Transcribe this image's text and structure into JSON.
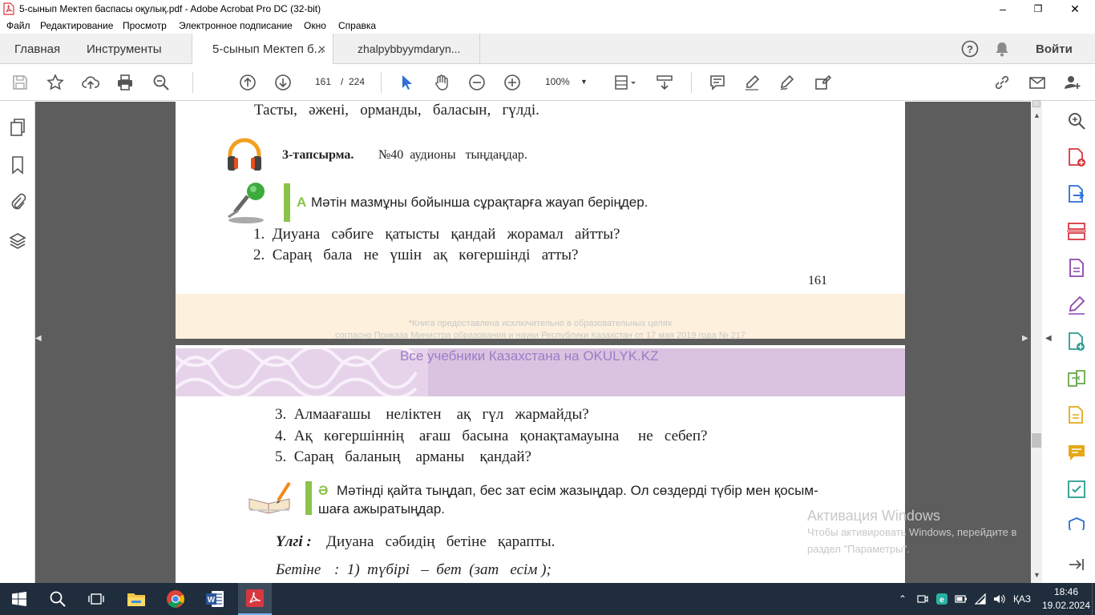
{
  "window": {
    "title": "5-сынып Мектеп баспасы оқулық.pdf - Adobe Acrobat Pro DC (32-bit)",
    "minimize": "–",
    "maximize": "❐",
    "close": "✕"
  },
  "menu": [
    "Файл",
    "Редактирование",
    "Просмотр",
    "Электронное подписание",
    "Окно",
    "Справка"
  ],
  "tabs": {
    "home": "Главная",
    "tools": "Инструменты",
    "doc1": "5-сынып Мектеп б...",
    "doc2": "zhalpybbyymdaryn...",
    "close": "✕",
    "signin": "Войти"
  },
  "toolbar": {
    "current_page": "161",
    "page_sep": "/",
    "total_pages": "224",
    "zoom": "100%"
  },
  "page_top": {
    "line_prev": "Тасты,   әжені,   орманды,   баласын,   гүлді.",
    "task_label": "3-тапсырма.",
    "task_text": "№40  аудионы   тыңдаңдар.",
    "section_a_letter": "А",
    "section_a_text": "Мәтін мазмұны бойынша сұрақтарға жауап беріңдер.",
    "q1": "1.  Диуана   сәбиге   қатысты   қандай   жорамал   айтты?",
    "q2": "2.  Сараң   бала   не   үшін   ақ   көгершінді   атты?",
    "page_number": "161",
    "footer_note1": "*Книга предоставлена исключительно в образовательных целях",
    "footer_note2": "согласно Приказа Министра образования и науки Республики Казахстан от 17 мая 2019 года № 217"
  },
  "page_bottom": {
    "banner_text": "Все учебники Казахстана на OKULYK.KZ",
    "q3": "3.  Алмаағашы    неліктен    ақ   гүл   жармайды?",
    "q4": "4.  Ақ   көгершіннің    ағаш   басына   қонақтамауына     не   себеп?",
    "q5": "5.  Сараң   баланың    арманы    қандай?",
    "section_b_letter": "Ә",
    "section_b_text1": "Мәтінді қайта тыңдап, бес зат есім жазыңдар. Ол сөздерді түбір мен қосым-",
    "section_b_text2": "шаға ажыратыңдар.",
    "sample_label": "Үлгі :",
    "sample_text": "Диуана   сәбидің   бетіне   қарапты.",
    "analysis_label": "Бетіне",
    "analysis_text": ":  1)  түбірі   –  бет  (зат   есім );"
  },
  "activation": {
    "title": "Активация Windows",
    "line1": "Чтобы активировать Windows, перейдите в",
    "line2": "раздел \"Параметры\"."
  },
  "taskbar": {
    "lang": "ҚАЗ",
    "time": "18:46",
    "date": "19.02.2024"
  },
  "colors": {
    "acrobat_red": "#d7373f",
    "banner_purple": "#d9c3e0",
    "page_beige": "#fdf0dc",
    "accent_green": "#8bc34a",
    "taskbar": "#1f2d3d",
    "icon_accent_blue": "#2d6fd6"
  }
}
